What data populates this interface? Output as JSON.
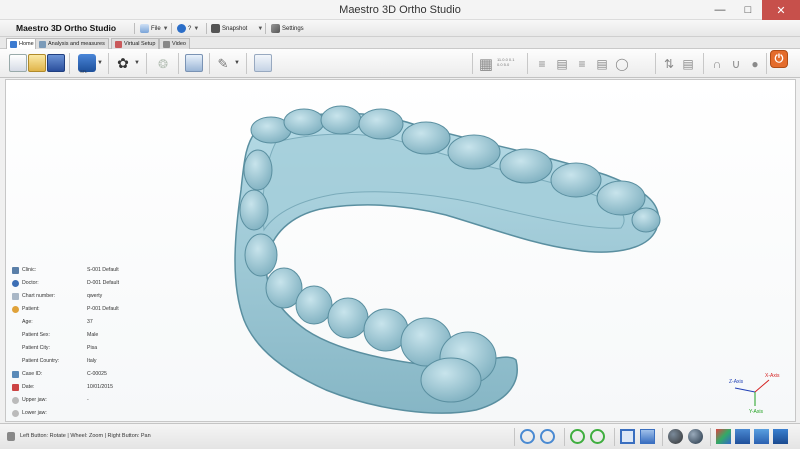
{
  "window": {
    "title": "Maestro 3D Ortho Studio"
  },
  "app": {
    "name": "Maestro 3D Ortho Studio"
  },
  "menu": {
    "file": "File",
    "help": "?",
    "snapshot": "Snapshot",
    "settings": "Settings"
  },
  "tabs": [
    {
      "label": "Home"
    },
    {
      "label": "Analysis and measures"
    },
    {
      "label": "Virtual Setup"
    },
    {
      "label": "Video"
    }
  ],
  "toolbar": {
    "stl_label": "STL",
    "grid_text_line1": "11.0.0 0.1",
    "grid_text_line2": "0.0 5.0"
  },
  "patient_info": [
    {
      "label": "Clinic:",
      "value": "S-001 Default",
      "icon": "clinic-icon"
    },
    {
      "label": "Doctor:",
      "value": "D-001 Default",
      "icon": "doctor-icon"
    },
    {
      "label": "Chart number:",
      "value": "qwerty",
      "icon": "chart-icon"
    },
    {
      "label": "Patient:",
      "value": "P-001 Default",
      "icon": "patient-icon"
    },
    {
      "label": "Age:",
      "value": "37",
      "icon": ""
    },
    {
      "label": "Patient Sex:",
      "value": "Male",
      "icon": ""
    },
    {
      "label": "Patient City:",
      "value": "Pisa",
      "icon": ""
    },
    {
      "label": "Patient Country:",
      "value": "Italy",
      "icon": ""
    },
    {
      "label": "Case ID:",
      "value": "C-00025",
      "icon": "case-icon"
    },
    {
      "label": "Date:",
      "value": "10/01/2015",
      "icon": "calendar-icon"
    },
    {
      "label": "Upper jaw:",
      "value": "-",
      "icon": "upper-jaw-icon"
    },
    {
      "label": "Lower jaw:",
      "value": "",
      "icon": "lower-jaw-icon"
    }
  ],
  "axis": {
    "x": "X-Axis",
    "y": "Y-Axis",
    "z": "Z-Axis"
  },
  "status": {
    "text": "Left Button: Rotate | Wheel: Zoom | Right Button: Pan"
  },
  "colors": {
    "model_fill": "#9cc9d6",
    "model_stroke": "#5a8fa0",
    "close_button": "#c7504b",
    "power_button": "#e46c2c"
  }
}
